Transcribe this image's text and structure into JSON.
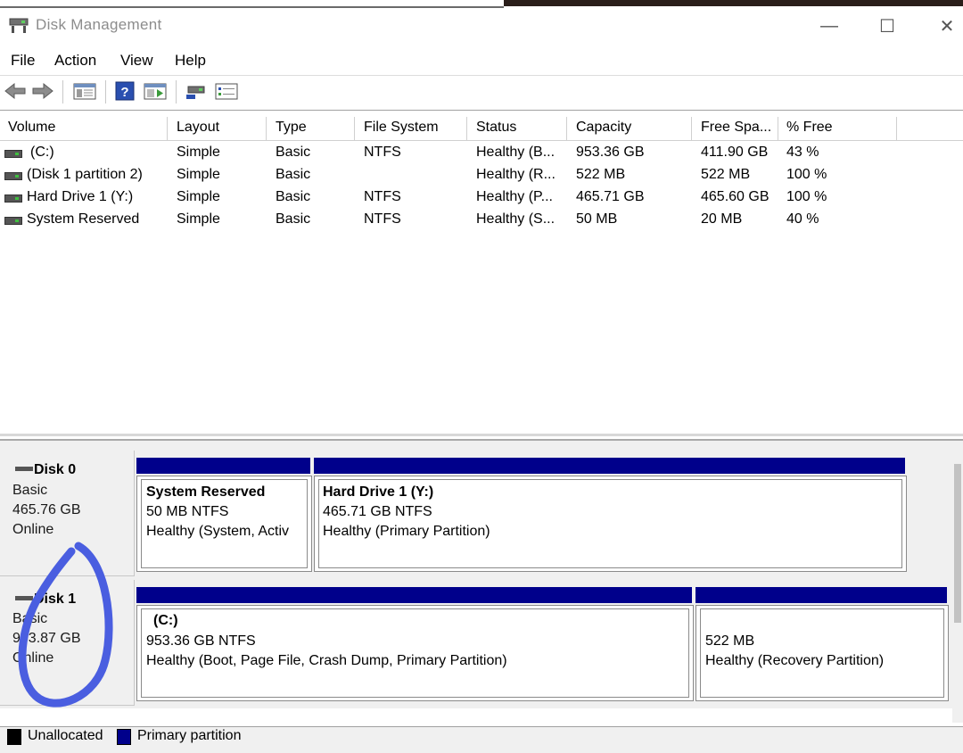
{
  "window": {
    "title": "Disk Management",
    "minimize_glyph": "—",
    "maximize_glyph": "☐",
    "close_glyph": "✕"
  },
  "menu": [
    "File",
    "Action",
    "View",
    "Help"
  ],
  "toolbar": {
    "icons": [
      "back-arrow-icon",
      "forward-arrow-icon",
      "show-hide-console-tree-icon",
      "help-icon",
      "properties-pane-icon",
      "connect-disk-icon",
      "settings-list-icon"
    ]
  },
  "volume_list": {
    "columns": [
      "Volume",
      "Layout",
      "Type",
      "File System",
      "Status",
      "Capacity",
      "Free Spa...",
      "% Free"
    ],
    "rows": [
      {
        "volume": "(C:)",
        "layout": "Simple",
        "type": "Basic",
        "fs": "NTFS",
        "status": "Healthy (B...",
        "capacity": "953.36 GB",
        "free": "411.90 GB",
        "pct": "43 %"
      },
      {
        "volume": "(Disk 1 partition 2)",
        "layout": "Simple",
        "type": "Basic",
        "fs": "",
        "status": "Healthy (R...",
        "capacity": "522 MB",
        "free": "522 MB",
        "pct": "100 %"
      },
      {
        "volume": "Hard Drive 1 (Y:)",
        "layout": "Simple",
        "type": "Basic",
        "fs": "NTFS",
        "status": "Healthy (P...",
        "capacity": "465.71 GB",
        "free": "465.60 GB",
        "pct": "100 %"
      },
      {
        "volume": "System Reserved",
        "layout": "Simple",
        "type": "Basic",
        "fs": "NTFS",
        "status": "Healthy (S...",
        "capacity": "50 MB",
        "free": "20 MB",
        "pct": "40 %"
      }
    ]
  },
  "disks": [
    {
      "name": "Disk 0",
      "type": "Basic",
      "size": "465.76 GB",
      "state": "Online",
      "partitions": [
        {
          "title": "System Reserved",
          "size": "50 MB NTFS",
          "status": "Healthy (System, Activ"
        },
        {
          "title": "Hard Drive 1  (Y:)",
          "size": "465.71 GB NTFS",
          "status": "Healthy (Primary Partition)"
        }
      ]
    },
    {
      "name": "Disk 1",
      "type": "Basic",
      "size": "953.87 GB",
      "state": "Online",
      "partitions": [
        {
          "title": "(C:)",
          "size": "953.36 GB NTFS",
          "status": "Healthy (Boot, Page File, Crash Dump, Primary Partition)"
        },
        {
          "title": "",
          "size": "522 MB",
          "status": "Healthy (Recovery Partition)"
        }
      ]
    }
  ],
  "legend": [
    {
      "label": "Unallocated",
      "color": "#000000"
    },
    {
      "label": "Primary partition",
      "color": "#00008b"
    }
  ],
  "annotation": {
    "color": "#4a5ee0",
    "shape": "hand-drawn-circle"
  }
}
